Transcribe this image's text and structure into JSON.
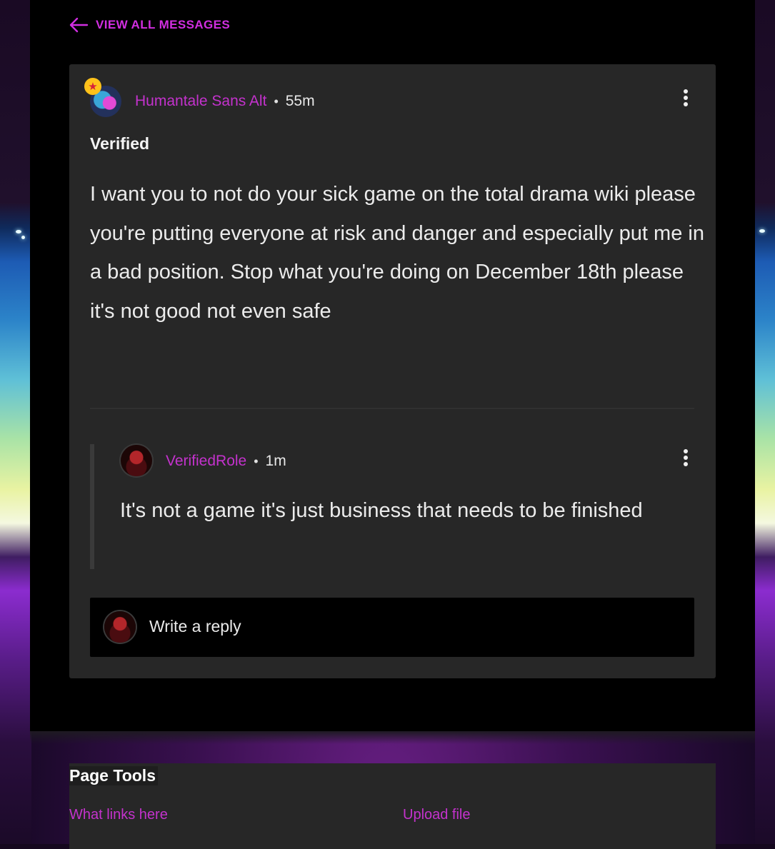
{
  "back_link": {
    "label": "VIEW ALL MESSAGES",
    "icon": "arrow-left-icon"
  },
  "message": {
    "author": "Humantale Sans Alt",
    "separator": "•",
    "time": "55m",
    "title": "Verified",
    "body": "I want you to not do your sick game on the total drama wiki please you're putting everyone at risk and danger and especially put me in a bad position. Stop what you're doing on December 18th please it's not good not even safe",
    "badge_icon": "star-icon",
    "menu_icon": "more-vertical-icon"
  },
  "reply": {
    "author": "VerifiedRole",
    "separator": "•",
    "time": "1m",
    "body": "It's not a game it's just business that needs to be finished",
    "menu_icon": "more-vertical-icon"
  },
  "reply_box": {
    "placeholder": "Write a reply"
  },
  "page_tools": {
    "title": "Page Tools",
    "links": [
      "What links here",
      "Upload file"
    ]
  },
  "colors": {
    "accent": "#c432cd",
    "card": "#272727",
    "page": "#000000"
  }
}
